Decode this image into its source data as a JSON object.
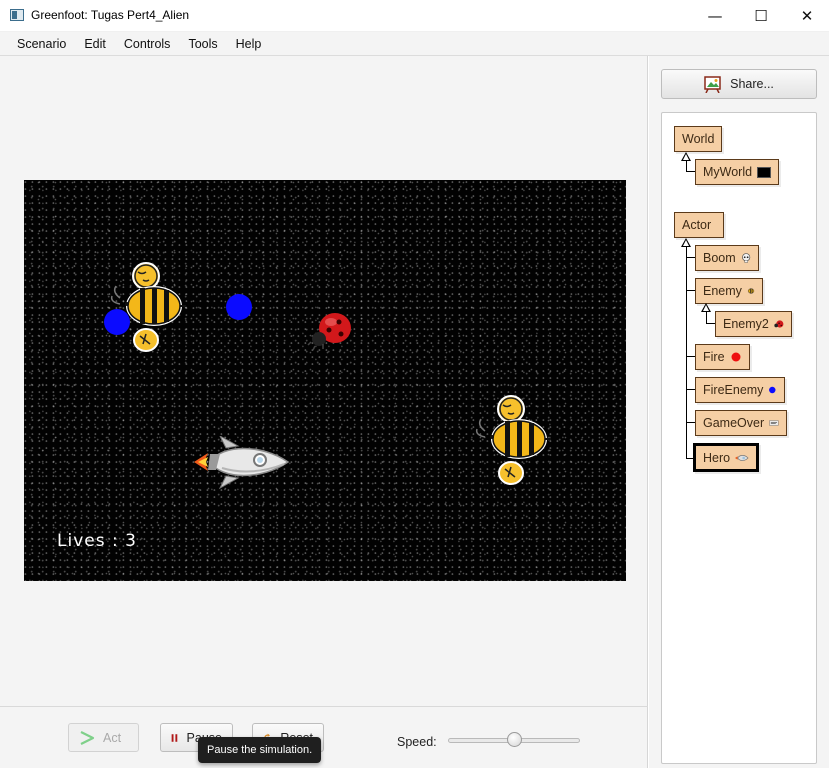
{
  "window": {
    "title": "Greenfoot: Tugas Pert4_Alien",
    "controls": {
      "minimize": "—",
      "maximize": "☐",
      "close": "✕"
    }
  },
  "menu": {
    "items": [
      "Scenario",
      "Edit",
      "Controls",
      "Tools",
      "Help"
    ]
  },
  "world": {
    "background": "#020202",
    "lives_text": "Lives : 3"
  },
  "controls": {
    "act_label": "Act",
    "pause_label": "Pause",
    "reset_label": "Reset",
    "speed_label": "Speed:",
    "speed_fraction": 0.5,
    "tooltip": "Pause the simulation."
  },
  "sidebar": {
    "share_label": "Share...",
    "classes": {
      "world": "World",
      "myworld": "MyWorld",
      "actor": "Actor",
      "boom": "Boom",
      "enemy": "Enemy",
      "enemy2": "Enemy2",
      "fire": "Fire",
      "fireenemy": "FireEnemy",
      "gameover": "GameOver",
      "hero": "Hero"
    },
    "selected_class": "Hero",
    "class_color": "#f5cfa5"
  }
}
